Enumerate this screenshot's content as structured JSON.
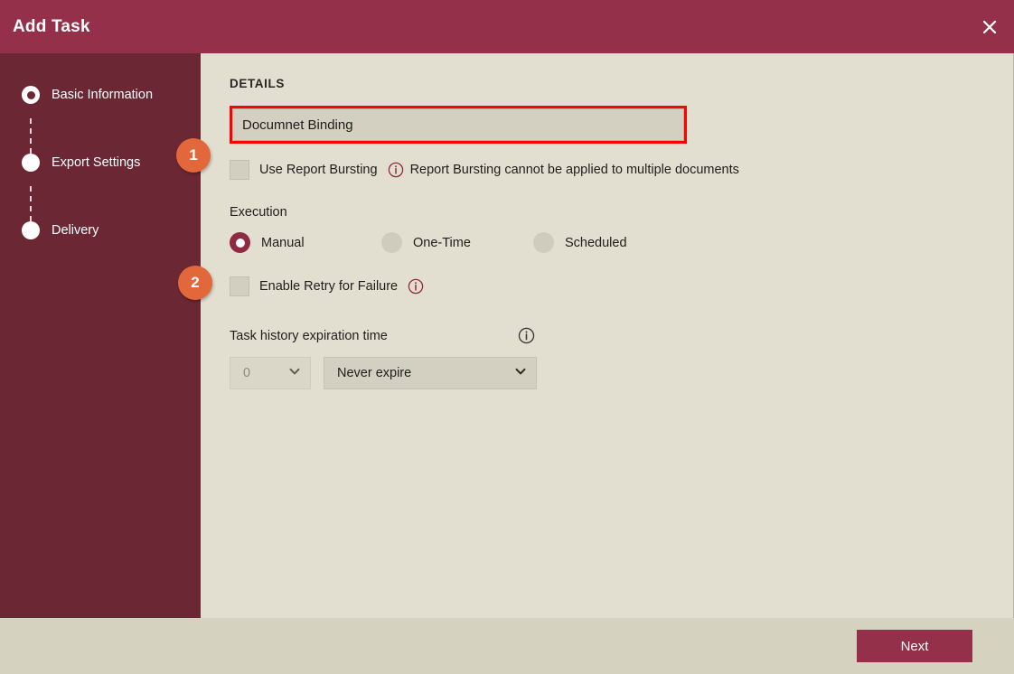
{
  "window": {
    "title": "Add Task",
    "close_icon": "close-icon"
  },
  "sidebar": {
    "steps": [
      {
        "label": "Basic Information",
        "state": "active"
      },
      {
        "label": "Export Settings",
        "state": "inactive"
      },
      {
        "label": "Delivery",
        "state": "inactive"
      }
    ]
  },
  "main": {
    "section_title": "DETAILS",
    "task_name": {
      "value": "Documnet Binding",
      "placeholder": "Task Name"
    },
    "report_bursting": {
      "label": "Use Report Bursting",
      "checked": false,
      "info_icon": "info-icon",
      "note": "Report Bursting cannot be applied to multiple documents"
    },
    "execution": {
      "label": "Execution",
      "options": [
        {
          "label": "Manual",
          "selected": true
        },
        {
          "label": "One-Time",
          "selected": false
        },
        {
          "label": "Scheduled",
          "selected": false
        }
      ]
    },
    "retry": {
      "label": "Enable Retry for Failure",
      "checked": false,
      "info_icon": "info-icon"
    },
    "expiration": {
      "label": "Task history expiration time",
      "info_icon": "info-icon",
      "amount": {
        "value": "0",
        "disabled": true,
        "chevron_icon": "chevron-down-icon"
      },
      "unit": {
        "value": "Never expire",
        "chevron_icon": "chevron-down-icon"
      }
    }
  },
  "footer": {
    "next_label": "Next"
  },
  "annotations": [
    {
      "number": "1"
    },
    {
      "number": "2"
    }
  ],
  "colors": {
    "header": "#95304a",
    "sidebar": "#6b2733",
    "content_bg": "#e3dfd0",
    "footer_bg": "#d5d2c0",
    "accent_badge": "#e2683c",
    "highlight_border": "#fe0000",
    "primary_button": "#95304a"
  }
}
